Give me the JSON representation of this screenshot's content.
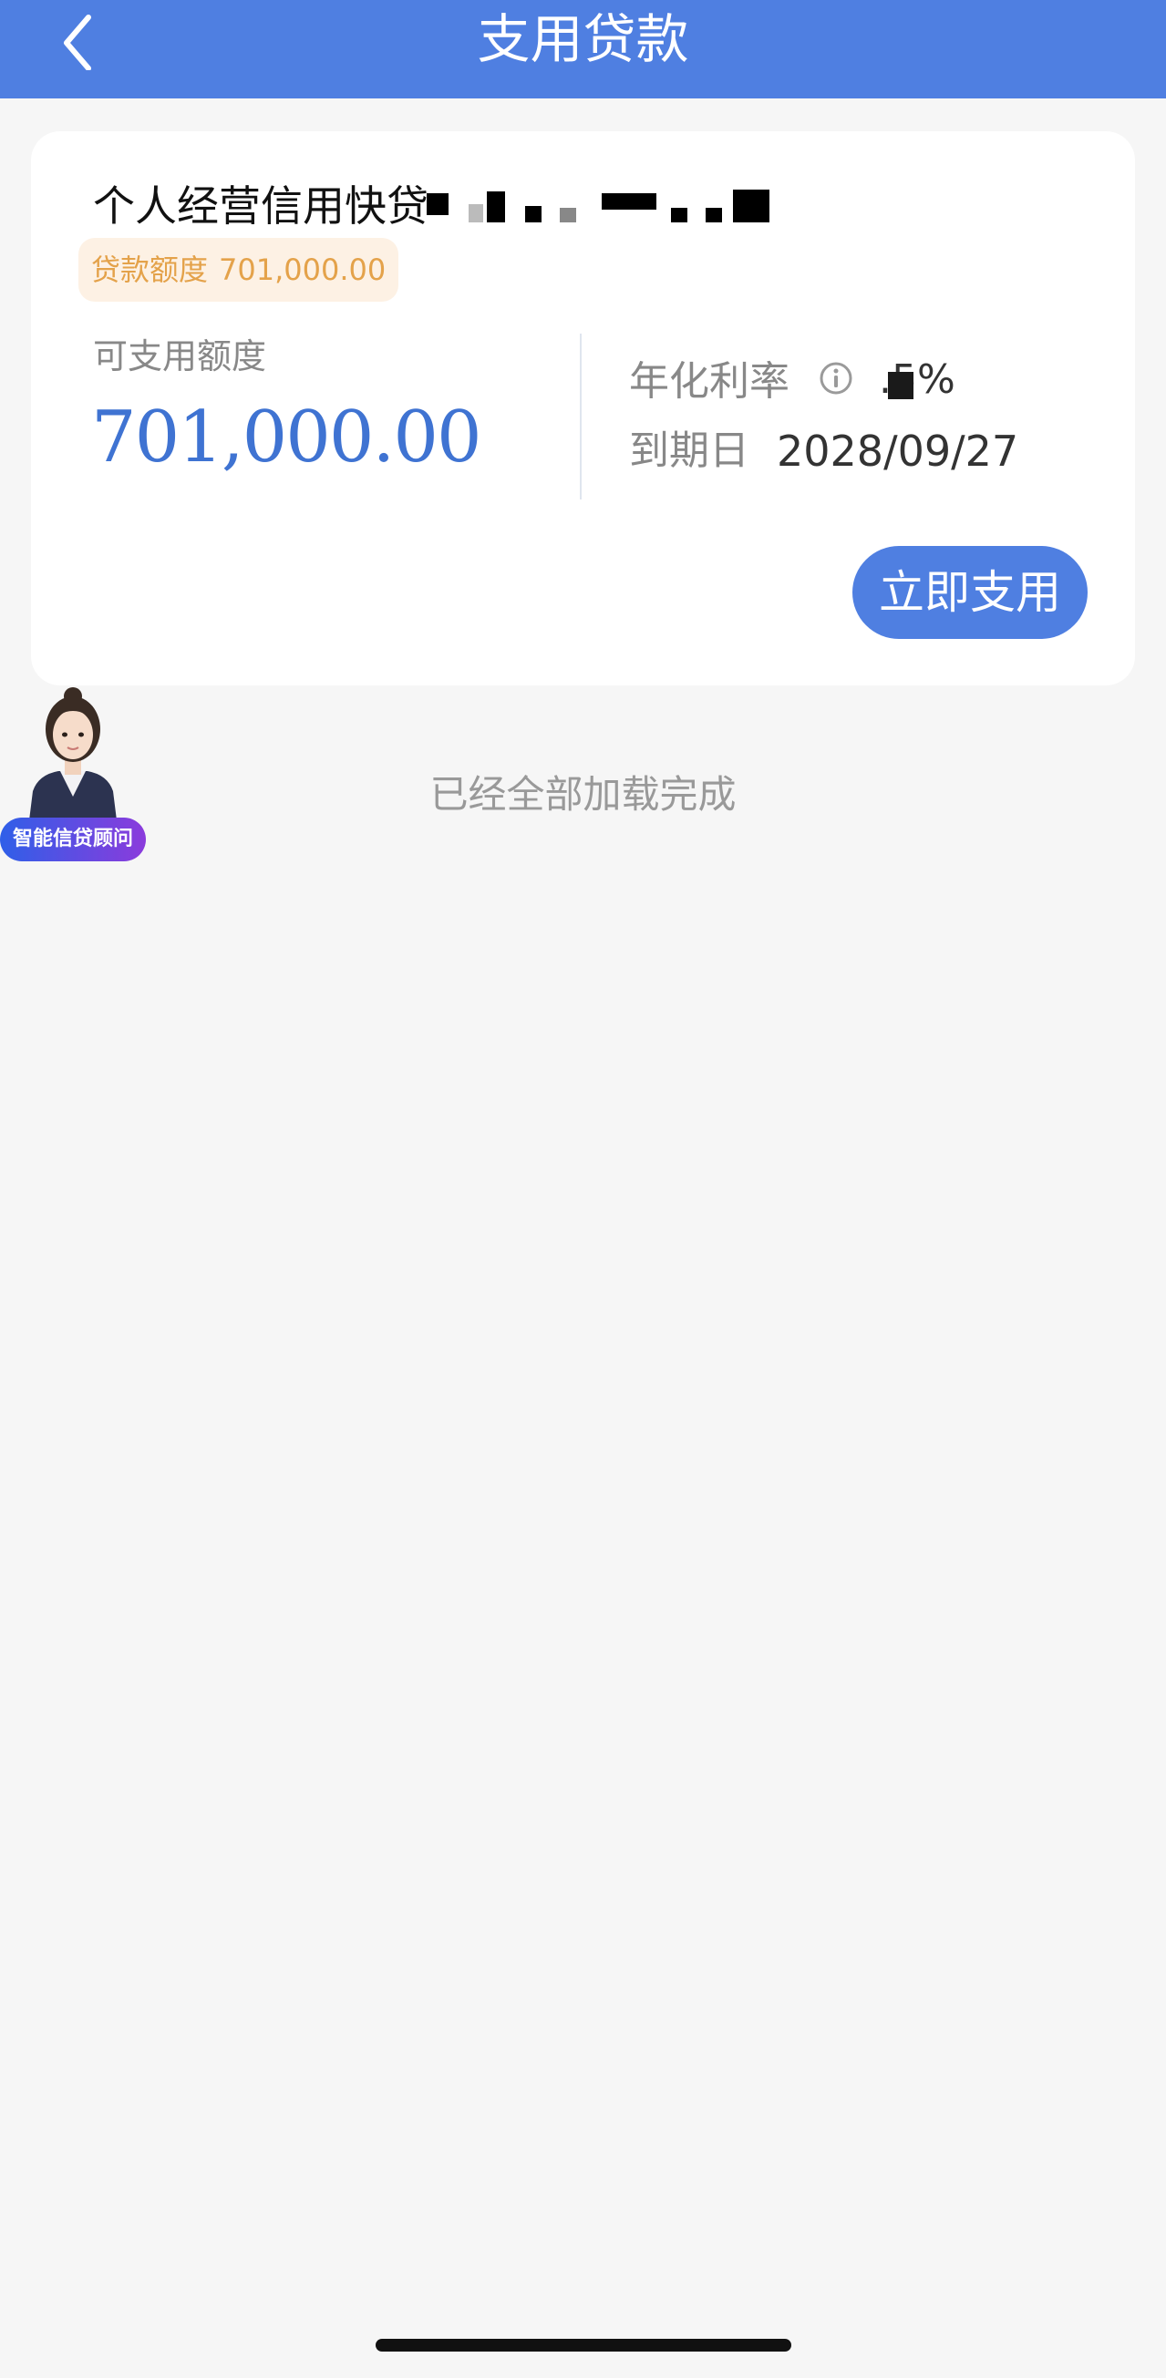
{
  "header": {
    "title": "支用贷款",
    "back_icon": "chevron-left-icon"
  },
  "loan_card": {
    "product_name": "个人经营信用快贷",
    "quota_label": "贷款额度",
    "quota_value": "701,000.00",
    "available_label": "可支用额度",
    "available_amount": "701,000.00",
    "rate_label": "年化利率",
    "rate_info_icon": "info-icon",
    "rate_value": "  .5%",
    "due_label": "到期日",
    "due_date": "2028/09/27",
    "use_button_label": "立即支用"
  },
  "status": {
    "loaded_text": "已经全部加载完成"
  },
  "advisor": {
    "label": "智能信贷顾问"
  },
  "colors": {
    "brand_blue": "#4f7fe1",
    "amount_blue": "#3f73d2",
    "quota_orange": "#e4a24a",
    "page_bg": "#f6f6f6"
  }
}
